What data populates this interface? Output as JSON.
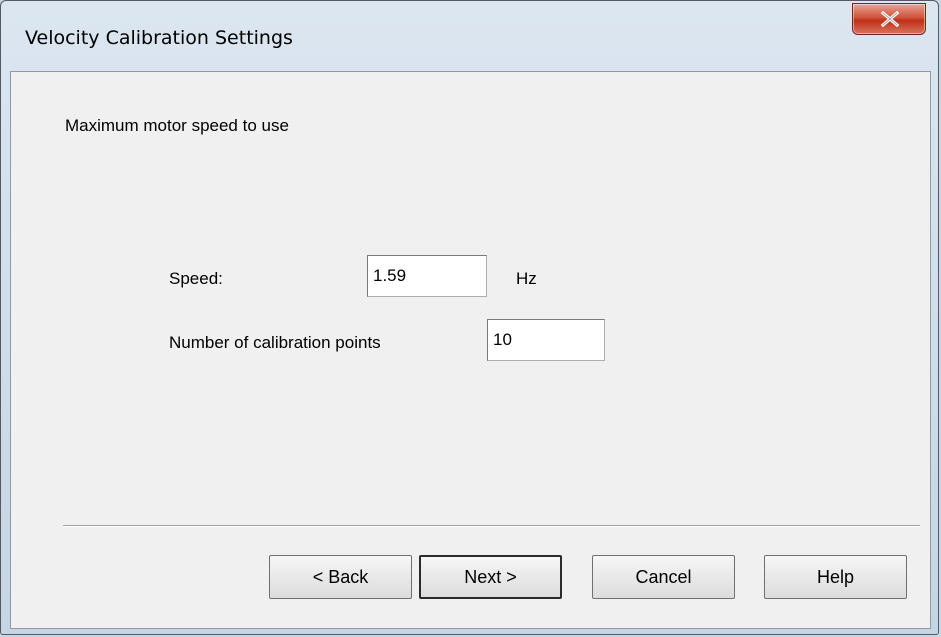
{
  "window": {
    "title": "Velocity Calibration Settings"
  },
  "content": {
    "heading": "Maximum motor speed to use",
    "speed_label": "Speed:",
    "speed_value": "1.59",
    "speed_unit": "Hz",
    "points_label": "Number of calibration points",
    "points_value": "10"
  },
  "buttons": {
    "back": "< Back",
    "next": "Next >",
    "cancel": "Cancel",
    "help": "Help"
  },
  "icons": {
    "close": "close-icon"
  }
}
